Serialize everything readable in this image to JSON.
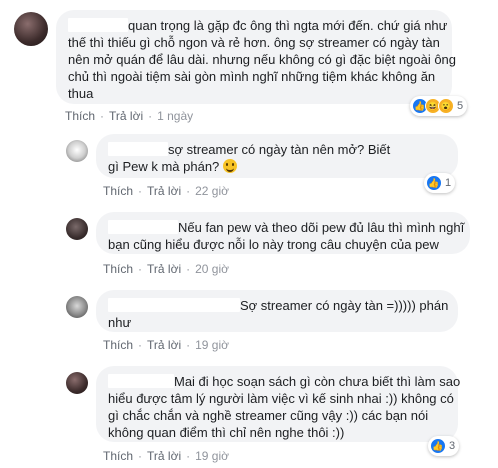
{
  "comments": [
    {
      "lines": [
        "quan trọng là gặp đc ông thì ngta mới đến. chứ giá như",
        "thế thì thiếu gì chỗ ngon và rẻ hơn. ông sợ streamer có ngày tàn",
        "nên mở quán để lâu dài. nhưng nếu không có gì đặc biệt ngoài ông",
        "chủ thì ngoài tiệm sài gòn mình nghĩ những tiệm khác không ăn",
        "thua"
      ],
      "like": "Thích",
      "reply": "Trả lời",
      "time": "1 ngày",
      "reaction_count": "5"
    },
    {
      "lines": [
        "sợ streamer có ngày tàn nên mở? Biết",
        "gì Pew k mà phán?"
      ],
      "like": "Thích",
      "reply": "Trả lời",
      "time": "22 giờ",
      "reaction_count": "1"
    },
    {
      "lines": [
        "Nếu fan pew và theo dõi pew đủ lâu thì mình nghĩ",
        "bạn cũng hiểu được nỗi lo này trong câu chuyện của pew"
      ],
      "like": "Thích",
      "reply": "Trả lời",
      "time": "20 giờ"
    },
    {
      "lines": [
        "Sợ streamer có ngày tàn =))))) phán",
        "như"
      ],
      "like": "Thích",
      "reply": "Trả lời",
      "time": "19 giờ"
    },
    {
      "lines": [
        "Mai đi học soạn sách gì còn chưa biết thì làm sao",
        "hiểu được tâm lý người làm việc vì kế sinh nhai :)) không có",
        "gì chắc chắn và nghề streamer cũng vậy :)) các bạn nói",
        "không quan điểm thì chỉ nên nghe thôi :))"
      ],
      "like": "Thích",
      "reply": "Trả lời",
      "time": "19 giờ",
      "reaction_count": "3"
    }
  ]
}
